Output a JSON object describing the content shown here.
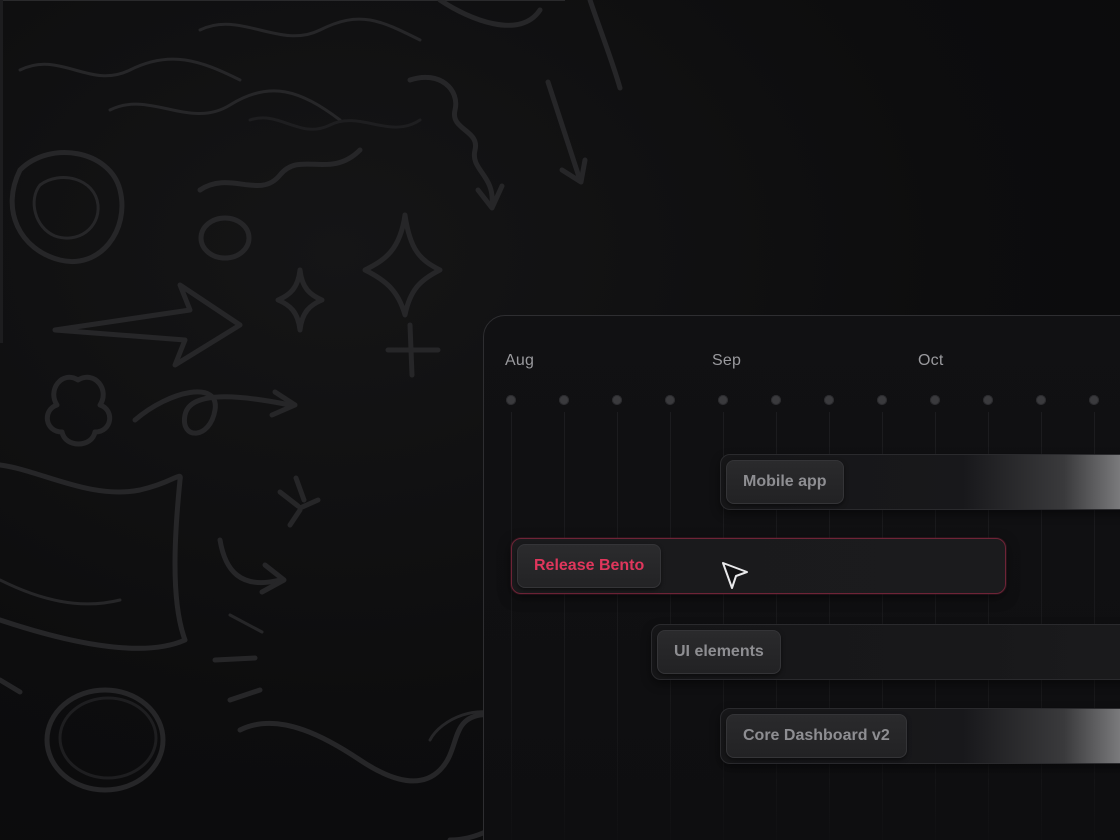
{
  "timeline": {
    "months": [
      "Aug",
      "Sep",
      "Oct"
    ],
    "tracks": [
      {
        "label": "Mobile app",
        "state": "default"
      },
      {
        "label": "Release Bento",
        "state": "active",
        "accent": "#e0365c"
      },
      {
        "label": "UI elements",
        "state": "default"
      },
      {
        "label": "Core Dashboard v2",
        "state": "default"
      }
    ]
  },
  "icons": {
    "cursor": "pointer-cursor-icon"
  }
}
